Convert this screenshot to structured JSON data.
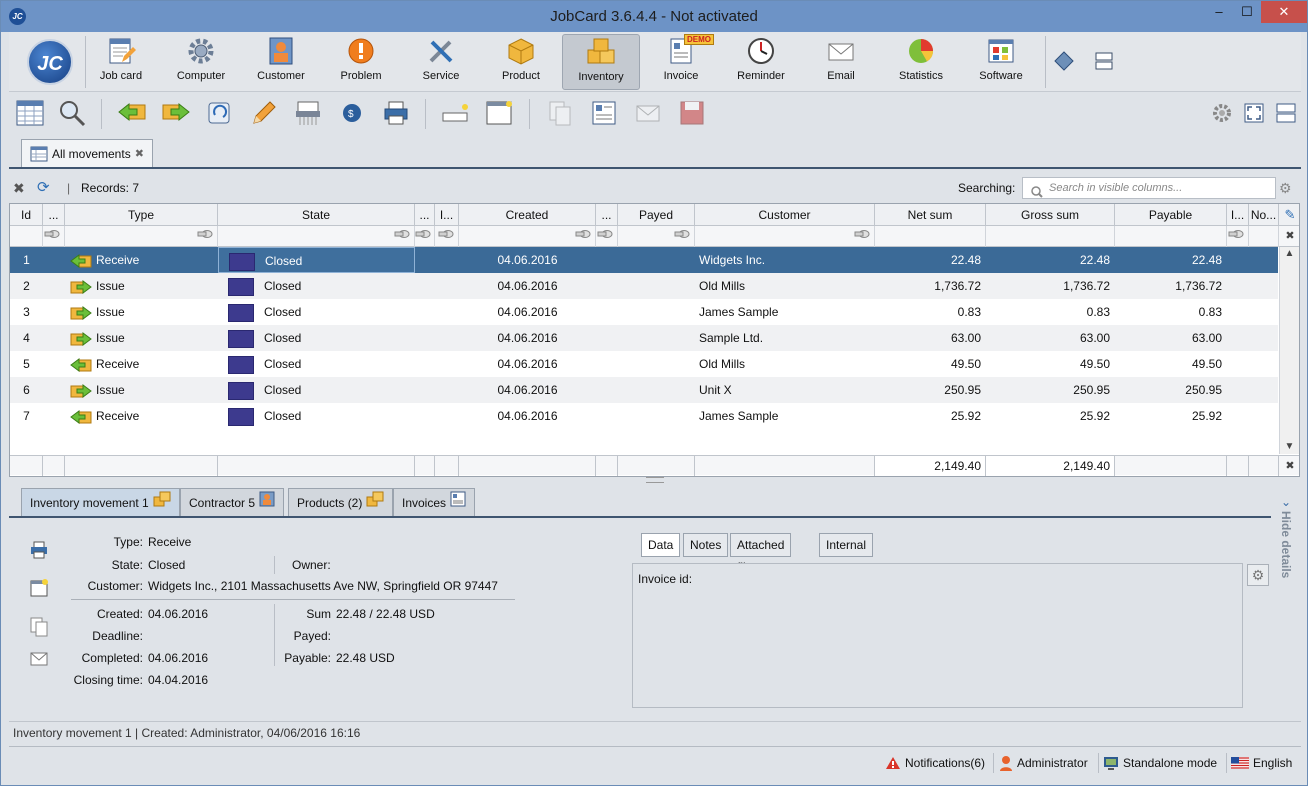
{
  "window": {
    "title": "JobCard 3.6.4.4 - Not activated",
    "minimize": "–",
    "maximize": "☐",
    "close": "✕",
    "app_icon": "JC"
  },
  "logo": "JC",
  "nav": [
    {
      "label": "Job card",
      "icon": "job-card-icon"
    },
    {
      "label": "Computer",
      "icon": "gear-icon"
    },
    {
      "label": "Customer",
      "icon": "customer-icon"
    },
    {
      "label": "Problem",
      "icon": "alert-icon"
    },
    {
      "label": "Service",
      "icon": "tools-icon"
    },
    {
      "label": "Product",
      "icon": "box-icon"
    },
    {
      "label": "Inventory",
      "icon": "boxes-icon",
      "active": true
    },
    {
      "label": "Invoice",
      "icon": "invoice-icon",
      "badge": "DEMO"
    },
    {
      "label": "Reminder",
      "icon": "clock-icon"
    },
    {
      "label": "Email",
      "icon": "envelope-icon"
    },
    {
      "label": "Statistics",
      "icon": "pie-chart-icon"
    },
    {
      "label": "Software",
      "icon": "software-icon"
    }
  ],
  "tabs": [
    {
      "label": "All movements",
      "close": "✖"
    }
  ],
  "records": {
    "label": "Records: 7",
    "searching_label": "Searching:",
    "search_placeholder": "Search in visible columns..."
  },
  "columns": [
    "Id",
    "...",
    "Type",
    "State",
    "...",
    "I...",
    "Created",
    "...",
    "Payed",
    "Customer",
    "Net sum",
    "Gross sum",
    "Payable",
    "I...",
    "No..."
  ],
  "rows": [
    {
      "id": "1",
      "type": "Receive",
      "state": "Closed",
      "created": "04.06.2016",
      "customer": "Widgets Inc.",
      "net": "22.48",
      "gross": "22.48",
      "payable": "22.48"
    },
    {
      "id": "2",
      "type": "Issue",
      "state": "Closed",
      "created": "04.06.2016",
      "customer": "Old Mills",
      "net": "1,736.72",
      "gross": "1,736.72",
      "payable": "1,736.72"
    },
    {
      "id": "3",
      "type": "Issue",
      "state": "Closed",
      "created": "04.06.2016",
      "customer": "James Sample",
      "net": "0.83",
      "gross": "0.83",
      "payable": "0.83"
    },
    {
      "id": "4",
      "type": "Issue",
      "state": "Closed",
      "created": "04.06.2016",
      "customer": "Sample Ltd.",
      "net": "63.00",
      "gross": "63.00",
      "payable": "63.00"
    },
    {
      "id": "5",
      "type": "Receive",
      "state": "Closed",
      "created": "04.06.2016",
      "customer": "Old Mills",
      "net": "49.50",
      "gross": "49.50",
      "payable": "49.50"
    },
    {
      "id": "6",
      "type": "Issue",
      "state": "Closed",
      "created": "04.06.2016",
      "customer": "Unit X",
      "net": "250.95",
      "gross": "250.95",
      "payable": "250.95"
    },
    {
      "id": "7",
      "type": "Receive",
      "state": "Closed",
      "created": "04.06.2016",
      "customer": "James Sample",
      "net": "25.92",
      "gross": "25.92",
      "payable": "25.92"
    }
  ],
  "totals": {
    "net": "2,149.40",
    "gross": "2,149.40"
  },
  "detail_tabs": [
    {
      "label": "Inventory movement 1"
    },
    {
      "label": "Contractor 5"
    },
    {
      "label": "Products (2)"
    },
    {
      "label": "Invoices"
    }
  ],
  "detail": {
    "type_label": "Type:",
    "type": "Receive",
    "state_label": "State:",
    "state": "Closed",
    "owner_label": "Owner:",
    "customer_label": "Customer:",
    "customer": "Widgets Inc., 2101 Massachusetts Ave NW, Springfield OR 97447",
    "created_label": "Created:",
    "created": "04.06.2016",
    "deadline_label": "Deadline:",
    "completed_label": "Completed:",
    "completed": "04.06.2016",
    "closing_label": "Closing time:",
    "closing": "04.04.2016",
    "sum_label": "Sum",
    "sum": "22.48 / 22.48 USD",
    "payed_label": "Payed:",
    "payable_label": "Payable:",
    "payable": "22.48 USD"
  },
  "sub_tabs": [
    "Data",
    "Notes",
    "Attached files",
    "Internal notes"
  ],
  "invoice_id_label": "Invoice id:",
  "hide_details": "Hide details",
  "status_line": "Inventory movement 1 | Created: Administrator, 04/06/2016 16:16",
  "bottom": {
    "notifications": "Notifications(6)",
    "user": "Administrator",
    "mode": "Standalone mode",
    "language": "English"
  }
}
